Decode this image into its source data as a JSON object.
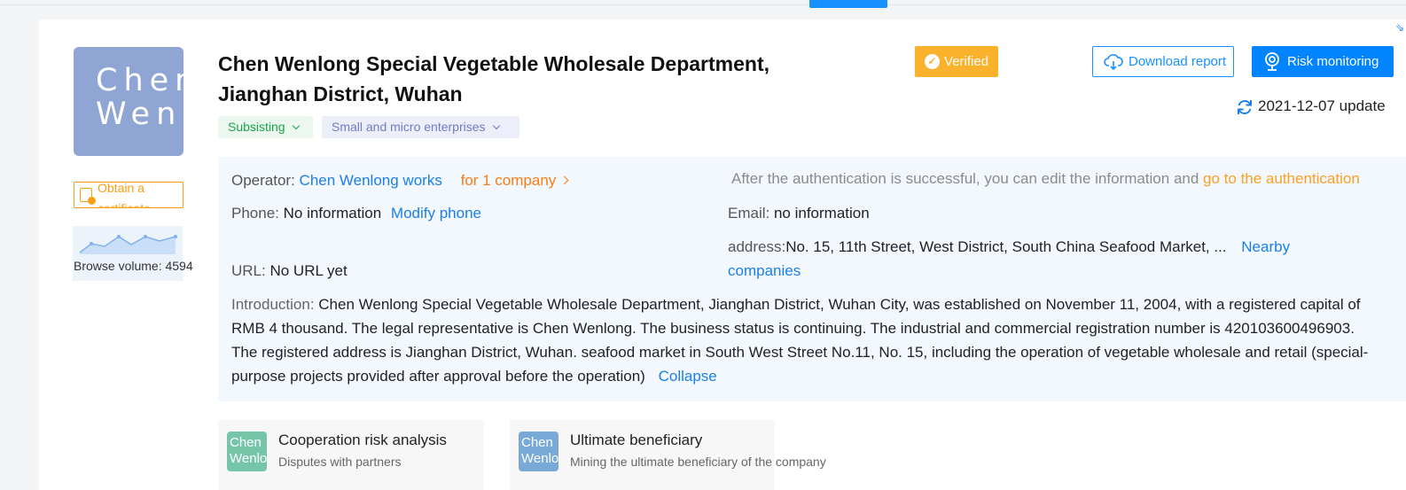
{
  "company": {
    "logo_text": "Chen Wenlong",
    "name": "Chen Wenlong Special Vegetable Wholesale Department, Jianghan District, Wuhan",
    "verified_label": "Verified",
    "status_tag": "Subsisting",
    "scale_tag": "Small and micro enterprises",
    "update_text": "2021-12-07 update"
  },
  "actions": {
    "download_label": "Download report",
    "risk_label": "Risk monitoring"
  },
  "sidebar": {
    "certificate_label": "Obtain a certificate",
    "browse_label": "Browse volume: 4594"
  },
  "info": {
    "operator_key": "Operator: ",
    "operator_value": "Chen Wenlong works",
    "operator_companies": "for 1 company",
    "auth_text": "After the authentication is successful, you can edit the information and ",
    "auth_link": "go to the authentication",
    "phone_key": "Phone: ",
    "phone_value": "No information",
    "phone_link": "Modify phone",
    "email_key": "Email: ",
    "email_value": "no information",
    "address_key": "address:",
    "address_value": "No. 15, 11th Street, West District, South China Seafood Market, ...",
    "address_link_1": "Nearby",
    "address_link_2": "companies",
    "url_key": "URL: ",
    "url_value": "No URL yet",
    "intro_key": "Introduction: ",
    "intro_text": "Chen Wenlong Special Vegetable Wholesale Department, Jianghan District, Wuhan City, was established on November 11, 2004, with a registered capital of RMB 4 thousand. The legal representative is Chen Wenlong. The business status is continuing. The industrial and commercial registration number is 420103600496903. The registered address is Jianghan District, Wuhan. seafood market in South West Street No.11, No. 15, including the operation of vegetable wholesale and retail (special-purpose projects provided after approval before the operation)",
    "collapse_label": "Collapse"
  },
  "features": [
    {
      "icon_text": "Chen Wenlong",
      "title": "Cooperation risk analysis",
      "subtitle": "Disputes with partners"
    },
    {
      "icon_text": "Chen Wenlong",
      "title": "Ultimate beneficiary",
      "subtitle": "Mining the ultimate beneficiary of the company"
    }
  ],
  "colors": {
    "accent": "#1890ff",
    "verified": "#fab12c",
    "status_green": "#17a34a",
    "link_orange": "#fa7d14"
  },
  "icons": {
    "verified": "check-badge-icon",
    "download": "cloud-download-icon",
    "risk": "monitor-camera-icon",
    "update": "refresh-icon",
    "certificate": "certificate-icon",
    "browse": "trend-chart-icon"
  }
}
